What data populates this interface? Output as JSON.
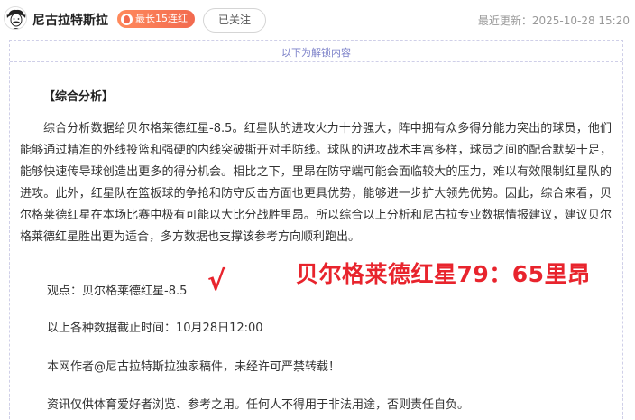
{
  "header": {
    "author_name": "尼古拉特斯拉",
    "streak_badge": "最长15连红",
    "follow_label": "已关注",
    "last_updated": "最近更新：2025-10-28 15:20"
  },
  "content": {
    "unlock_notice": "以下为解锁内容",
    "section_title": "【综合分析】",
    "analysis": "综合分析数据给贝尔格莱德红星-8.5。红星队的进攻火力十分强大，阵中拥有众多得分能力突出的球员，他们能够通过精准的外线投篮和强硬的内线突破撕开对手防线。球队的进攻战术丰富多样，球员之间的配合默契十足，能够快速传导球创造出更多的得分机会。相比之下，里昂在防守端可能会面临较大的压力，难以有效限制红星队的进攻。此外，红星队在篮板球的争抢和防守反击方面也更具优势，能够进一步扩大领先优势。因此，综合来看，贝尔格莱德红星在本场比赛中极有可能以大比分战胜里昂。所以综合以上分析和尼古拉专业数据情报建议，建议贝尔格莱德红星胜出更为适合，多方数据也支撑该参考方向顺利跑出。",
    "viewpoint": "观点：贝尔格莱德红星-8.5",
    "check_mark": "√",
    "final_score": "贝尔格莱德红星79：65里昂",
    "data_cutoff": "以上各种数据截止时间：10月28日12:00",
    "copyright": "本网作者@尼古拉特斯拉独家稿件，未经许可严禁转载！",
    "disclaimer": "资讯仅供体育爱好者浏览、参考之用。任何人不得用于非法用途，否则责任自负。"
  },
  "colors": {
    "accent_red": "#e8242d",
    "badge_orange": "#f26a4f",
    "unlock_blue": "#7a7fc8"
  },
  "icons": {
    "avatar": "einstein-avatar",
    "streak": "flame-icon"
  }
}
